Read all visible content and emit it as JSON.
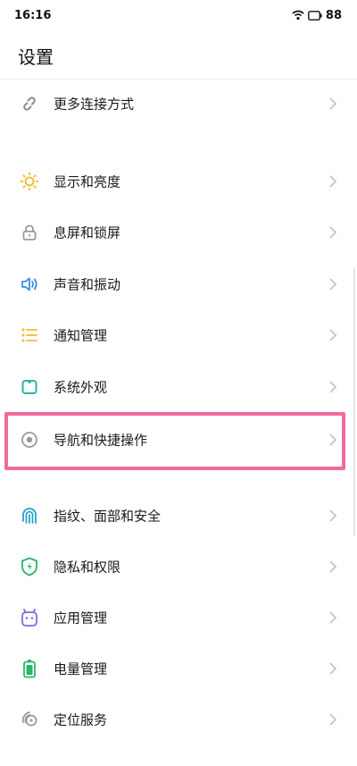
{
  "status_bar": {
    "time": "16:16",
    "battery": "88"
  },
  "header": {
    "title": "设置"
  },
  "items": [
    {
      "label": "更多连接方式",
      "icon": "link-icon",
      "color": "#8c8c8c"
    },
    {
      "label": "显示和亮度",
      "icon": "sun-icon",
      "color": "#f5b82e"
    },
    {
      "label": "息屏和锁屏",
      "icon": "lock-icon",
      "color": "#9a9a9a"
    },
    {
      "label": "声音和振动",
      "icon": "speaker-icon",
      "color": "#3a8ee6"
    },
    {
      "label": "通知管理",
      "icon": "list-icon",
      "color": "#f5b82e"
    },
    {
      "label": "系统外观",
      "icon": "theme-icon",
      "color": "#2bb3a6"
    },
    {
      "label": "导航和快捷操作",
      "icon": "navigation-icon",
      "color": "#9a9a9a"
    },
    {
      "label": "指纹、面部和安全",
      "icon": "fingerprint-icon",
      "color": "#2aa0c8"
    },
    {
      "label": "隐私和权限",
      "icon": "shield-icon",
      "color": "#2bb56a"
    },
    {
      "label": "应用管理",
      "icon": "app-icon",
      "color": "#7a6fd6"
    },
    {
      "label": "电量管理",
      "icon": "battery-icon",
      "color": "#2bb56a"
    },
    {
      "label": "定位服务",
      "icon": "location-icon",
      "color": "#9a9a9a"
    }
  ],
  "highlight_color": "#f06aa0"
}
